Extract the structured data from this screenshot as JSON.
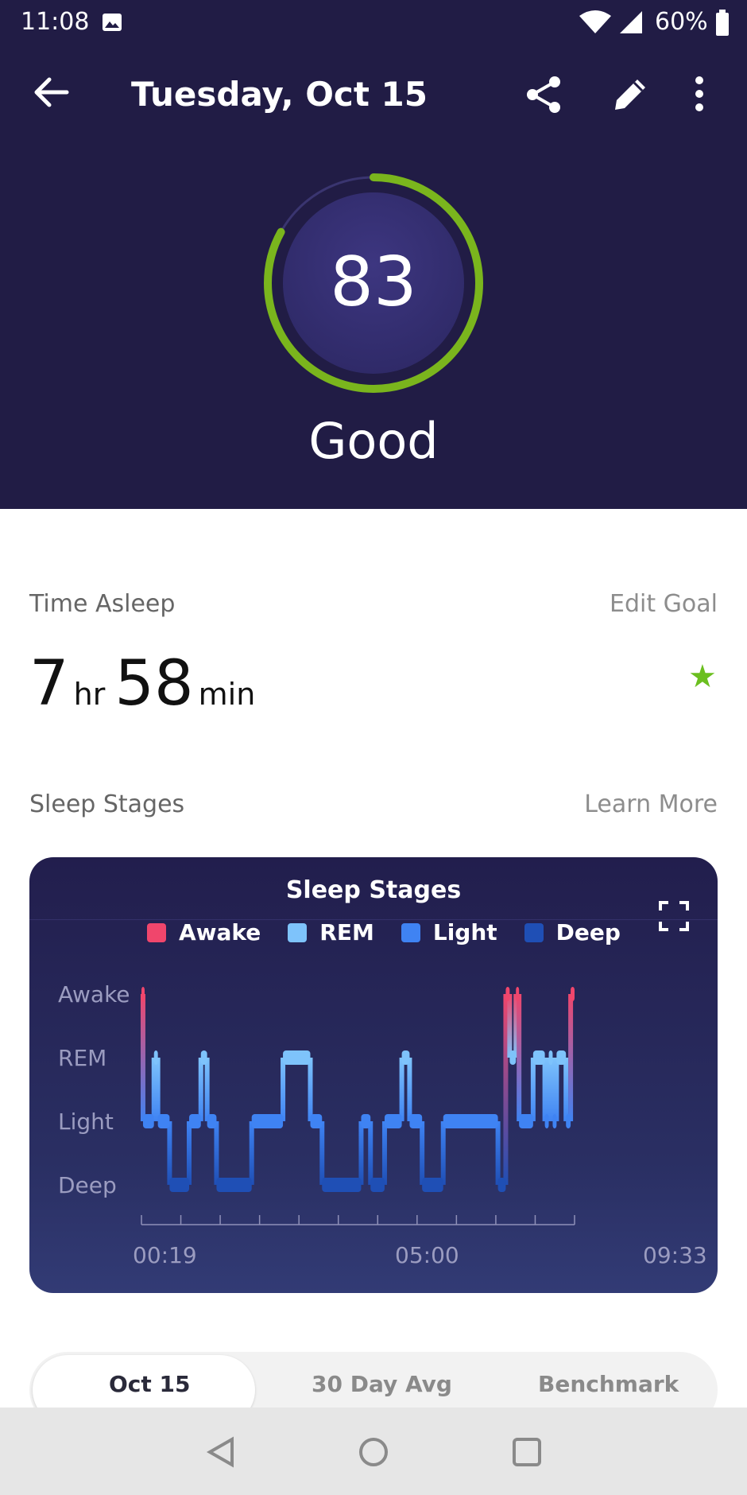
{
  "status_bar": {
    "time": "11:08",
    "battery": "60%"
  },
  "app_bar": {
    "title": "Tuesday, Oct 15"
  },
  "score": {
    "value": "83",
    "label": "Good",
    "fraction": 0.83,
    "ring_color": "#7ab51d"
  },
  "time_asleep": {
    "label": "Time Asleep",
    "edit_link": "Edit Goal",
    "hours": "7",
    "hours_unit": "hr",
    "minutes": "58",
    "minutes_unit": "min"
  },
  "sleep_stages_section": {
    "label": "Sleep Stages",
    "learn_more": "Learn More"
  },
  "chart_data": {
    "type": "line",
    "title": "Sleep Stages",
    "legend": [
      {
        "name": "Awake",
        "color": "#f0466c"
      },
      {
        "name": "REM",
        "color": "#7ec3fb"
      },
      {
        "name": "Light",
        "color": "#3f83f3"
      },
      {
        "name": "Deep",
        "color": "#1f4fb5"
      }
    ],
    "y_levels": [
      "Awake",
      "REM",
      "Light",
      "Deep"
    ],
    "x_ticks": [
      "00:19",
      "05:00",
      "09:33"
    ],
    "x_range": [
      "00:19",
      "09:33"
    ],
    "stage_sequence": [
      [
        "00:19",
        "00:21",
        "Awake"
      ],
      [
        "00:21",
        "00:35",
        "Light"
      ],
      [
        "00:35",
        "00:40",
        "REM"
      ],
      [
        "00:40",
        "00:55",
        "Light"
      ],
      [
        "00:55",
        "01:20",
        "Deep"
      ],
      [
        "01:20",
        "01:35",
        "Light"
      ],
      [
        "01:35",
        "01:43",
        "REM"
      ],
      [
        "01:43",
        "01:55",
        "Light"
      ],
      [
        "01:55",
        "02:40",
        "Deep"
      ],
      [
        "02:40",
        "03:20",
        "Light"
      ],
      [
        "03:20",
        "03:55",
        "REM"
      ],
      [
        "03:55",
        "04:10",
        "Light"
      ],
      [
        "04:10",
        "05:00",
        "Deep"
      ],
      [
        "05:00",
        "05:12",
        "Light"
      ],
      [
        "05:12",
        "05:30",
        "Deep"
      ],
      [
        "05:30",
        "05:52",
        "Light"
      ],
      [
        "05:52",
        "06:02",
        "REM"
      ],
      [
        "06:02",
        "06:18",
        "Light"
      ],
      [
        "06:18",
        "06:45",
        "Deep"
      ],
      [
        "06:45",
        "07:55",
        "Light"
      ],
      [
        "07:55",
        "08:05",
        "Deep"
      ],
      [
        "08:05",
        "08:10",
        "Awake"
      ],
      [
        "08:10",
        "08:18",
        "REM"
      ],
      [
        "08:18",
        "08:22",
        "Awake"
      ],
      [
        "08:22",
        "08:40",
        "Light"
      ],
      [
        "08:40",
        "08:55",
        "REM"
      ],
      [
        "08:55",
        "09:00",
        "Light"
      ],
      [
        "09:00",
        "09:05",
        "REM"
      ],
      [
        "09:05",
        "09:10",
        "Light"
      ],
      [
        "09:10",
        "09:22",
        "REM"
      ],
      [
        "09:22",
        "09:28",
        "Light"
      ],
      [
        "09:28",
        "09:33",
        "Awake"
      ]
    ]
  },
  "tabs": {
    "items": [
      "Oct 15",
      "30 Day Avg",
      "Benchmark"
    ],
    "active": "Oct 15"
  }
}
